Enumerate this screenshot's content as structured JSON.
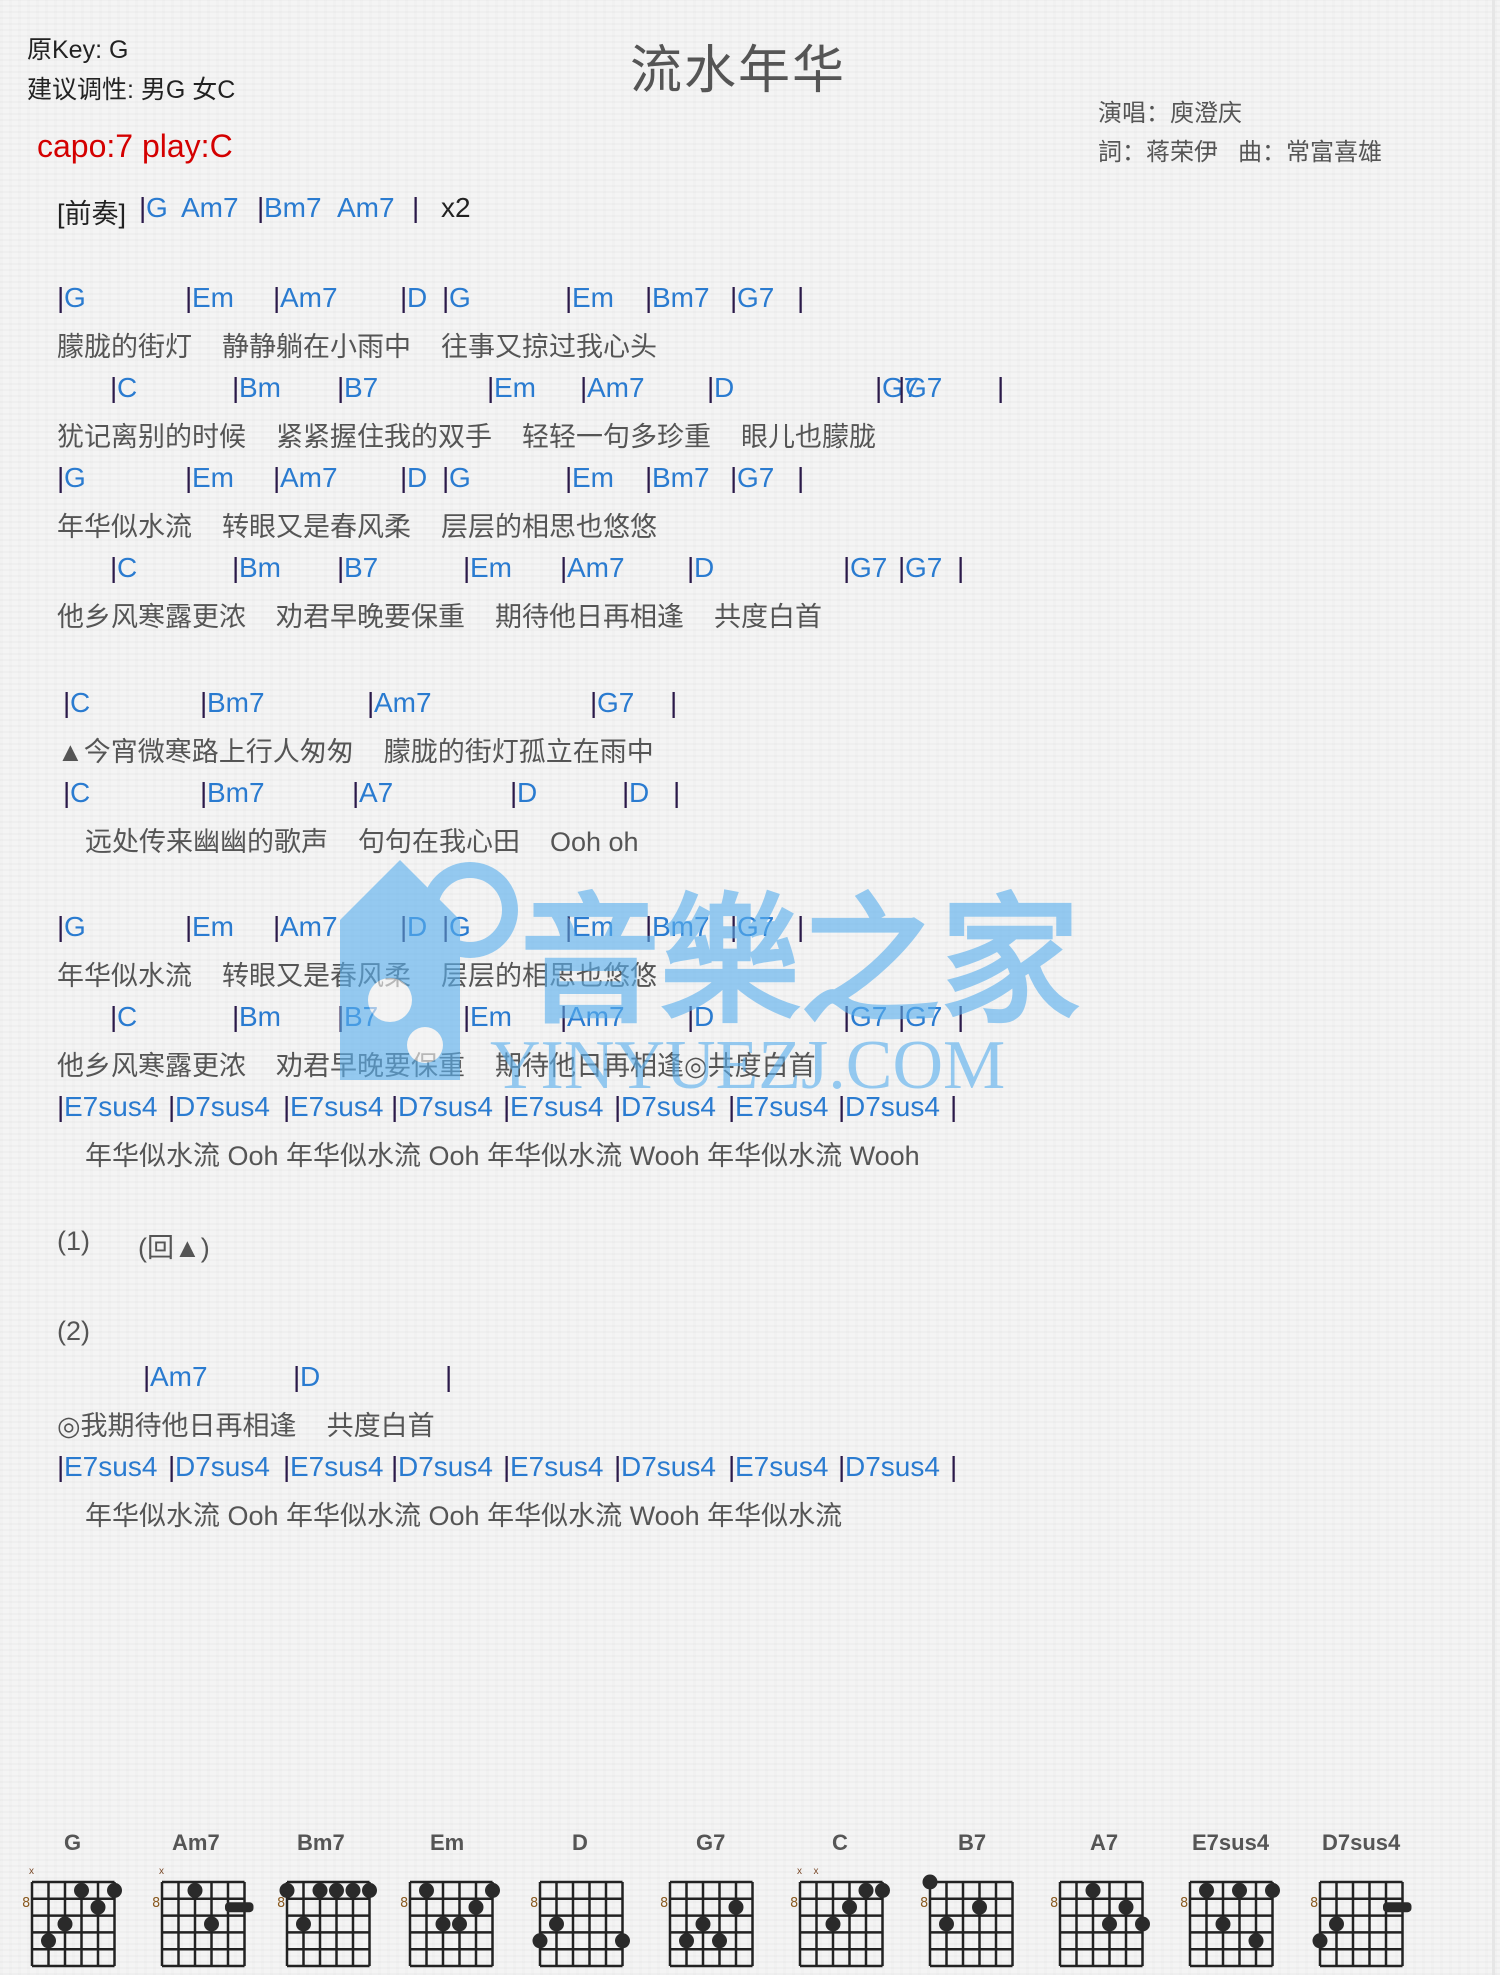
{
  "header": {
    "original_key": "原Key: G",
    "suggested_key": "建议调性: 男G 女C",
    "capo": "capo:7 play:C",
    "title": "流水年华",
    "singer": "演唱：庾澄庆",
    "writers": "詞：蒋荣伊   曲：常富喜雄"
  },
  "intro": {
    "label": "[前奏]",
    "chords": [
      "G",
      "Am7",
      "Bm7",
      "Am7"
    ],
    "repeat": "x2"
  },
  "sections": [
    {
      "lines": [
        {
          "chords": [
            "G",
            "Em",
            "Am7",
            "D",
            "G",
            "Em",
            "Bm7",
            "G7"
          ],
          "lyric": "朦胧的街灯    静静躺在小雨中    往事又掠过我心头"
        },
        {
          "chords": [
            "C",
            "Bm",
            "B7",
            "Em",
            "Am7",
            "D",
            "G7",
            "G7"
          ],
          "lyric": "犹记离别的时候    紧紧握住我的双手    轻轻一句多珍重    眼儿也朦胧"
        },
        {
          "chords": [
            "G",
            "Em",
            "Am7",
            "D",
            "G",
            "Em",
            "Bm7",
            "G7"
          ],
          "lyric": "年华似水流    转眼又是春风柔    层层的相思也悠悠"
        },
        {
          "chords": [
            "C",
            "Bm",
            "B7",
            "Em",
            "Am7",
            "D",
            "G7",
            "G7"
          ],
          "lyric": "他乡风寒露更浓    劝君早晚要保重    期待他日再相逢    共度白首"
        }
      ]
    },
    {
      "lines": [
        {
          "chords": [
            "C",
            "Bm7",
            "Am7",
            "G7"
          ],
          "lyric": "▲今宵微寒路上行人匆匆    朦胧的街灯孤立在雨中"
        },
        {
          "chords": [
            "C",
            "Bm7",
            "A7",
            "D",
            "D"
          ],
          "lyric": "远处传来幽幽的歌声    句句在我心田    Ooh oh"
        }
      ]
    },
    {
      "lines": [
        {
          "chords": [
            "G",
            "Em",
            "Am7",
            "D",
            "G",
            "Em",
            "Bm7",
            "G7"
          ],
          "lyric": "年华似水流    转眼又是春风柔    层层的相思也悠悠"
        },
        {
          "chords": [
            "C",
            "Bm",
            "B7",
            "Em",
            "Am7",
            "D",
            "G7",
            "G7"
          ],
          "lyric": "他乡风寒露更浓    劝君早晚要保重    期待他日再相逢◎共度白首"
        },
        {
          "chords": [
            "E7sus4",
            "D7sus4",
            "E7sus4",
            "D7sus4",
            "E7sus4",
            "D7sus4",
            "E7sus4",
            "D7sus4"
          ],
          "lyric": "年华似水流 Ooh 年华似水流 Ooh 年华似水流 Wooh 年华似水流 Wooh"
        }
      ]
    }
  ],
  "ending": {
    "part1_label": "(1)",
    "part1_text": "(回▲)",
    "part2_label": "(2)",
    "lines": [
      {
        "chords": [
          "Am7",
          "D"
        ],
        "lyric": "◎我期待他日再相逢    共度白首"
      },
      {
        "chords": [
          "E7sus4",
          "D7sus4",
          "E7sus4",
          "D7sus4",
          "E7sus4",
          "D7sus4",
          "E7sus4",
          "D7sus4"
        ],
        "lyric": "年华似水流 Ooh 年华似水流 Ooh 年华似水流 Wooh 年华似水流"
      }
    ]
  },
  "watermark": {
    "cn": "音樂之家",
    "en": "YINYUEZJ.COM",
    "color": "#5ab0ee"
  },
  "colors": {
    "chord": "#2a7bd0",
    "capo": "#d40000",
    "bar": "#2b1a4a"
  },
  "chord_diagrams": [
    {
      "name": "G",
      "fret": "8",
      "muted": [
        1
      ],
      "dots": [
        [
          4,
          1
        ],
        [
          6,
          1
        ],
        [
          5,
          2
        ],
        [
          3,
          3
        ],
        [
          2,
          4
        ]
      ],
      "barres": []
    },
    {
      "name": "Am7",
      "fret": "8",
      "muted": [
        1
      ],
      "dots": [
        [
          3,
          1
        ],
        [
          4,
          3
        ]
      ],
      "barres": [
        [
          5,
          6,
          2
        ]
      ]
    },
    {
      "name": "Bm7",
      "fret": "8",
      "muted": [],
      "dots": [
        [
          1,
          1
        ],
        [
          3,
          1
        ],
        [
          4,
          1
        ],
        [
          5,
          1
        ],
        [
          6,
          1
        ],
        [
          2,
          3
        ]
      ],
      "barres": []
    },
    {
      "name": "Em",
      "fret": "8",
      "muted": [],
      "dots": [
        [
          2,
          1
        ],
        [
          6,
          1
        ],
        [
          5,
          2
        ],
        [
          3,
          3
        ],
        [
          4,
          3
        ]
      ],
      "barres": []
    },
    {
      "name": "D",
      "fret": "8",
      "muted": [],
      "dots": [
        [
          2,
          3
        ],
        [
          1,
          4
        ],
        [
          6,
          4
        ]
      ],
      "barres": []
    },
    {
      "name": "G7",
      "fret": "8",
      "muted": [],
      "dots": [
        [
          5,
          2
        ],
        [
          3,
          3
        ],
        [
          2,
          4
        ],
        [
          4,
          4
        ]
      ],
      "barres": []
    },
    {
      "name": "C",
      "fret": "8",
      "muted": [
        1,
        2
      ],
      "dots": [
        [
          5,
          1
        ],
        [
          6,
          1
        ],
        [
          4,
          2
        ],
        [
          3,
          3
        ]
      ],
      "barres": []
    },
    {
      "name": "B7",
      "fret": "8",
      "muted": [],
      "dots": [
        [
          1,
          0.5
        ],
        [
          4,
          2
        ],
        [
          2,
          3
        ]
      ],
      "barres": []
    },
    {
      "name": "A7",
      "fret": "8",
      "muted": [],
      "dots": [
        [
          3,
          1
        ],
        [
          5,
          2
        ],
        [
          4,
          3
        ],
        [
          6,
          3
        ]
      ],
      "barres": []
    },
    {
      "name": "E7sus4",
      "fret": "8",
      "muted": [],
      "dots": [
        [
          2,
          1
        ],
        [
          4,
          1
        ],
        [
          6,
          1
        ],
        [
          3,
          3
        ],
        [
          5,
          4
        ]
      ],
      "barres": []
    },
    {
      "name": "D7sus4",
      "fret": "8",
      "muted": [],
      "dots": [
        [
          2,
          3
        ],
        [
          1,
          4
        ]
      ],
      "barres": [
        [
          5,
          6,
          2
        ]
      ]
    }
  ]
}
